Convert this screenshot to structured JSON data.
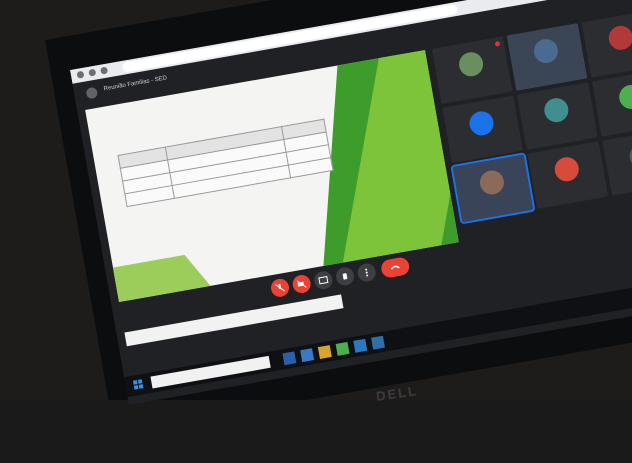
{
  "scene": {
    "background_color": "#1e1c1a",
    "laptop_brand": "DELL"
  },
  "browser": {
    "address": "",
    "meet_title": "Reunião Familias - SED"
  },
  "slide": {
    "text": "",
    "table_rows": [
      [
        "",
        "",
        ""
      ],
      [
        "",
        "",
        ""
      ],
      [
        "",
        "",
        ""
      ],
      [
        "",
        "",
        ""
      ]
    ]
  },
  "controls": [
    {
      "icon": "mic-off-icon",
      "color": "#ea4335"
    },
    {
      "icon": "camera-off-icon",
      "color": "#ea4335"
    },
    {
      "icon": "present-icon",
      "color": "#3c4043"
    },
    {
      "icon": "hand-icon",
      "color": "#3c4043"
    },
    {
      "icon": "more-icon",
      "color": "#3c4043"
    },
    {
      "icon": "leave-call-icon",
      "color": "#ea4335"
    }
  ],
  "participants": [
    {
      "name": "",
      "avatar_color": "#6a8f5e"
    },
    {
      "name": "",
      "avatar_color": "#4a6a8f"
    },
    {
      "name": "",
      "avatar_color": "#b33838"
    },
    {
      "name": "",
      "avatar_color": "#1a73e8"
    },
    {
      "name": "",
      "avatar_color": "#3f8f8f"
    },
    {
      "name": "",
      "avatar_color": "#4caf50"
    },
    {
      "name": "",
      "avatar_color": "#8a6a5a"
    },
    {
      "name": "",
      "avatar_color": "#d84a3a"
    },
    {
      "name": "",
      "avatar_color": "#555a60"
    }
  ],
  "footer": {
    "meeting_code": "",
    "notification": ""
  },
  "taskbar": {
    "search_placeholder": ""
  }
}
